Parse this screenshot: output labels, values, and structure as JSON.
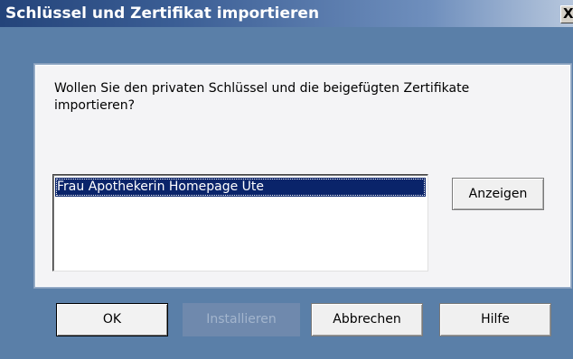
{
  "window": {
    "title": "Schlüssel und Zertifikat importieren",
    "close_glyph": "X"
  },
  "main": {
    "message": "Wollen Sie den privaten Schlüssel und die beigefügten Zertifikate importieren?",
    "list_items": [
      "Frau Apothekerin Homepage Ute"
    ],
    "view_button": "Anzeigen"
  },
  "buttons": {
    "ok": "OK",
    "install": "Installieren",
    "cancel": "Abbrechen",
    "help": "Hilfe"
  },
  "colors": {
    "titlebar_start": "#24447a",
    "dialog_background": "#5a7fa8",
    "selection": "#0a246a"
  }
}
